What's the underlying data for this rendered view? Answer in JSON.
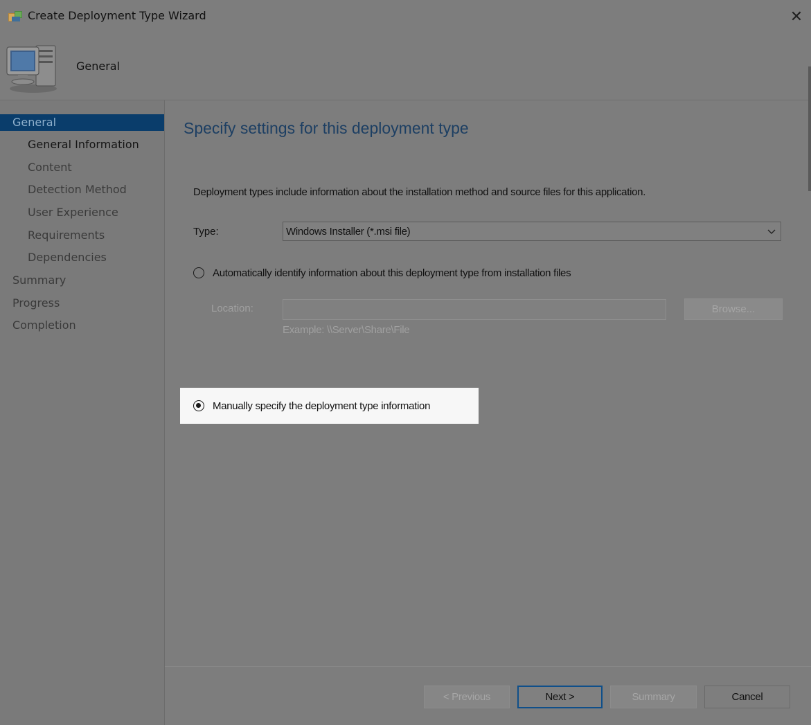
{
  "window": {
    "title": "Create Deployment Type Wizard",
    "close_glyph": "✕",
    "icon": "wizard-app-icon"
  },
  "header": {
    "title": "General",
    "icon": "computer-icon"
  },
  "sidebar": {
    "items": [
      {
        "label": "General",
        "level": 0,
        "selected": true
      },
      {
        "label": "General Information",
        "level": 1,
        "current": true
      },
      {
        "label": "Content",
        "level": 1
      },
      {
        "label": "Detection Method",
        "level": 1
      },
      {
        "label": "User Experience",
        "level": 1
      },
      {
        "label": "Requirements",
        "level": 1
      },
      {
        "label": "Dependencies",
        "level": 1
      },
      {
        "label": "Summary",
        "level": 0
      },
      {
        "label": "Progress",
        "level": 0
      },
      {
        "label": "Completion",
        "level": 0
      }
    ]
  },
  "main": {
    "heading": "Specify settings for this deployment type",
    "description": "Deployment types include information about the installation method and source files for this application.",
    "type_label": "Type:",
    "type_value": "Windows Installer (*.msi file)",
    "auto_option": {
      "label": "Automatically identify information about this deployment type from installation files",
      "checked": false
    },
    "location_label": "Location:",
    "location_value": "",
    "browse_label": "Browse...",
    "example_text": "Example: \\\\Server\\Share\\File",
    "manual_option": {
      "label": "Manually specify the deployment type information",
      "checked": true
    }
  },
  "footer": {
    "previous_label": "< Previous",
    "next_label": "Next >",
    "summary_label": "Summary",
    "cancel_label": "Cancel"
  },
  "colors": {
    "accent": "#0f4f8a",
    "selected_bg": "#0a3d6b",
    "heading": "#1d3f63",
    "highlight": "#f7f7f7"
  }
}
